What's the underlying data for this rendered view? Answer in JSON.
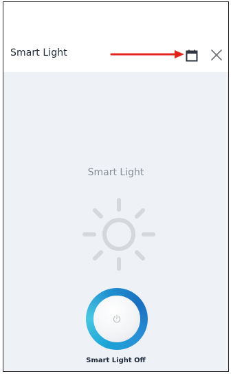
{
  "header": {
    "title": "Smart Light",
    "calendar_icon": "calendar-icon",
    "close_icon": "close-icon",
    "annotation_arrow_color": "#e0261c"
  },
  "device": {
    "name": "Smart Light",
    "icon": "sun-icon",
    "power_button_icon": "power-icon",
    "status": "Smart Light Off",
    "ring_color": "#1aa3d6"
  }
}
